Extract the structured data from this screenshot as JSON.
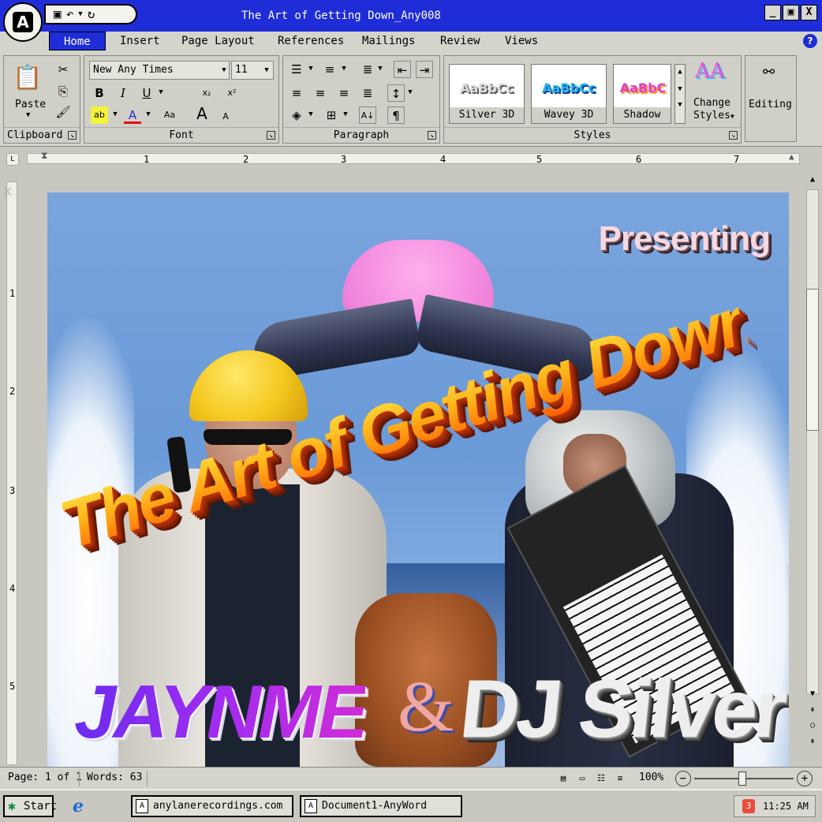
{
  "window": {
    "title": "The Art of Getting Down_Any008",
    "controls": {
      "minimize": "_",
      "maximize": "▣",
      "close": "X"
    }
  },
  "quick_access": {
    "save_icon": "floppy-disk",
    "undo_icon": "undo-arrow",
    "redo_icon": "redo-arrow"
  },
  "tabs": [
    {
      "label": "Home",
      "active": true
    },
    {
      "label": "Insert"
    },
    {
      "label": "Page Layout"
    },
    {
      "label": "References"
    },
    {
      "label": "Mailings"
    },
    {
      "label": "Review"
    },
    {
      "label": "Views"
    }
  ],
  "ribbon": {
    "clipboard": {
      "label": "Clipboard",
      "paste_label": "Paste"
    },
    "font": {
      "label": "Font",
      "font_name": "New Any Times",
      "font_size": "11"
    },
    "paragraph": {
      "label": "Paragraph"
    },
    "styles": {
      "label": "Styles",
      "tiles": [
        {
          "name": "Silver 3D",
          "preview": "AaBbCc"
        },
        {
          "name": "Wavey 3D",
          "preview": "AaBbCc"
        },
        {
          "name": "Shadow",
          "preview": "AaBbC"
        }
      ],
      "change_styles_line1": "Change",
      "change_styles_line2": "Styles"
    },
    "editing": {
      "label": "Editing"
    }
  },
  "ruler": {
    "numbers": [
      "1",
      "2",
      "3",
      "4",
      "5",
      "6",
      "7"
    ]
  },
  "vruler": {
    "numbers": [
      "1",
      "2",
      "3",
      "4",
      "5"
    ]
  },
  "poster": {
    "presenting": "Presenting",
    "title": "The Art of Getting Down",
    "artist1": "JAYNME",
    "ampersand": "&",
    "artist2": "DJ Silver"
  },
  "status": {
    "page": "Page: 1 of 1",
    "words": "Words: 63",
    "zoom": "100%"
  },
  "taskbar": {
    "start": "Start",
    "task1": "anylanerecordings.com",
    "task2": "Document1-AnyWord",
    "time": "11:25 AM"
  }
}
